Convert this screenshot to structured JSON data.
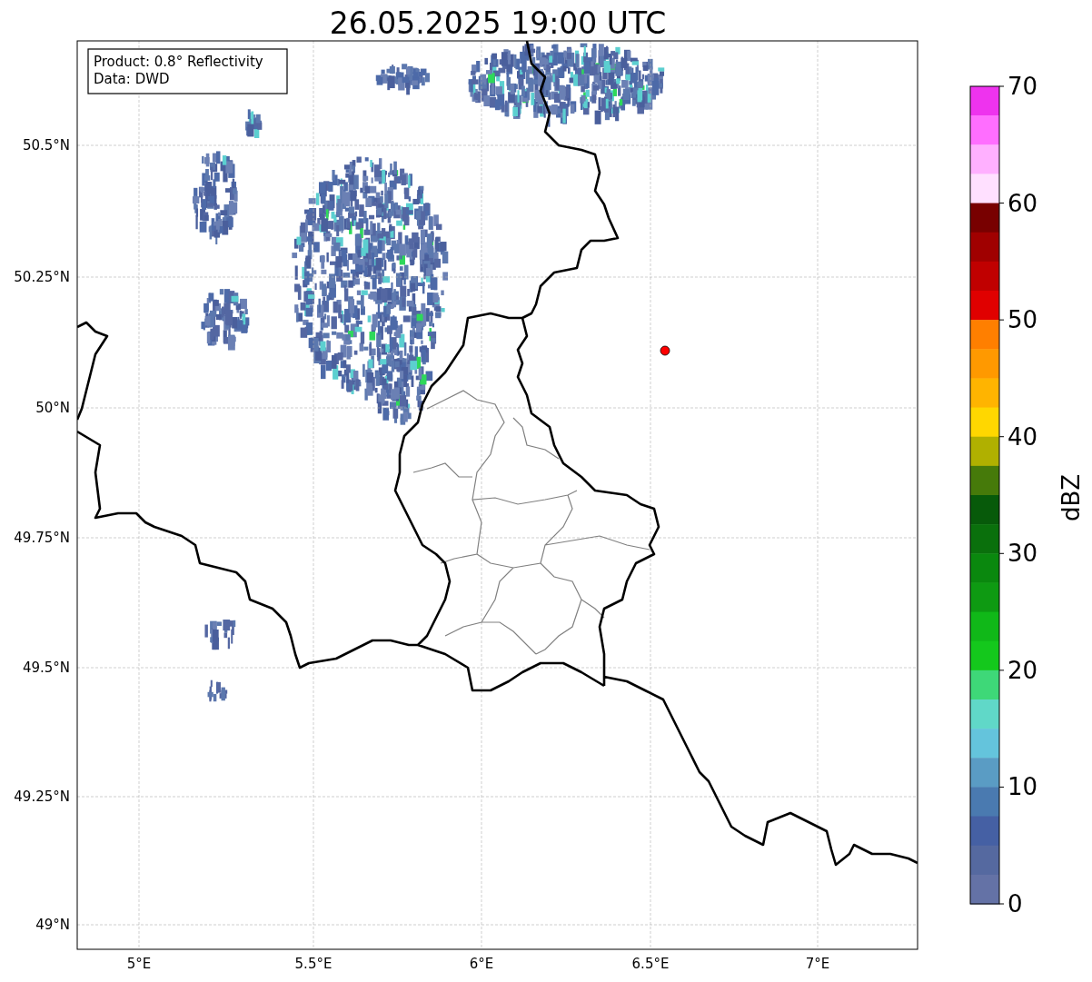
{
  "title": "26.05.2025 19:00 UTC",
  "info_box": [
    "Product: 0.8° Reflectivity",
    "Data: DWD"
  ],
  "x_ticks": [
    "5°E",
    "5.5°E",
    "6°E",
    "6.5°E",
    "7°E"
  ],
  "y_ticks": [
    "50.5°N",
    "50.25°N",
    "50°N",
    "49.75°N",
    "49.5°N",
    "49.25°N",
    "49°N"
  ],
  "colorbar": {
    "label": "dBZ",
    "ticks": [
      "70",
      "60",
      "50",
      "40",
      "30",
      "20",
      "10",
      "0"
    ],
    "bins": [
      {
        "color": "#ee33ee"
      },
      {
        "color": "#ff6eff"
      },
      {
        "color": "#ffb0ff"
      },
      {
        "color": "#ffe0ff"
      },
      {
        "color": "#780000"
      },
      {
        "color": "#a00000"
      },
      {
        "color": "#c00000"
      },
      {
        "color": "#e00000"
      },
      {
        "color": "#ff7f00"
      },
      {
        "color": "#ff9900"
      },
      {
        "color": "#ffb400"
      },
      {
        "color": "#ffd700"
      },
      {
        "color": "#b0b000"
      },
      {
        "color": "#467a0a"
      },
      {
        "color": "#075a0a"
      },
      {
        "color": "#0a700c"
      },
      {
        "color": "#0a880e"
      },
      {
        "color": "#0e9a12"
      },
      {
        "color": "#10b818"
      },
      {
        "color": "#14c81c"
      },
      {
        "color": "#3ed878"
      },
      {
        "color": "#60d8c8"
      },
      {
        "color": "#64c4dc"
      },
      {
        "color": "#5a9cc4"
      },
      {
        "color": "#4a7ab0"
      },
      {
        "color": "#4560a4"
      },
      {
        "color": "#5569a0"
      },
      {
        "color": "#6472a6"
      }
    ]
  }
}
